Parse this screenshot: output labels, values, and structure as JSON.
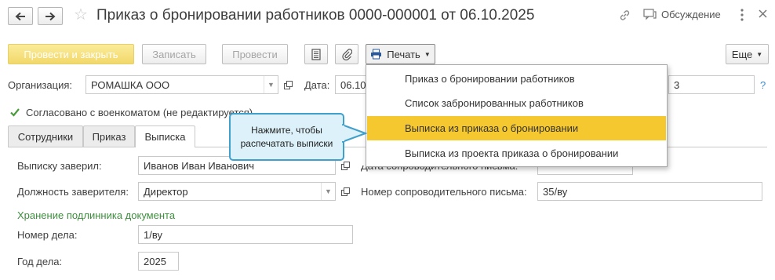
{
  "window": {
    "title": "Приказ о бронировании работников 0000-000001 от 06.10.2025",
    "discussion_label": "Обсуждение"
  },
  "icons": {
    "back": "arrow-left-icon",
    "forward": "arrow-right-icon",
    "favorite": "star-icon",
    "link": "link-icon",
    "discussion": "chat-icon",
    "more": "more-vertical-icon",
    "close": "close-icon"
  },
  "toolbar": {
    "post_close": "Провести и закрыть",
    "save": "Записать",
    "post": "Провести",
    "print": "Печать",
    "more": "Еще"
  },
  "header": {
    "org_label": "Организация:",
    "org_value": "РОМАШКА ООО",
    "date_label": "Дата:",
    "date_value": "06.10",
    "number_value": "3",
    "help": "?",
    "agreed_label": "Согласовано с военкоматом (не редактируется)",
    "agreed_checked": true
  },
  "tabs": [
    {
      "label": "Сотрудники",
      "active": false
    },
    {
      "label": "Приказ",
      "active": false
    },
    {
      "label": "Выписка",
      "active": true
    }
  ],
  "form": {
    "certified_label": "Выписку заверил:",
    "certified_value": "Иванов Иван Иванович",
    "position_label": "Должность заверителя:",
    "position_value": "Директор",
    "storage_header": "Хранение подлинника документа",
    "case_number_label": "Номер дела:",
    "case_number_value": "1/ву",
    "case_year_label": "Год дела:",
    "case_year_value": "2025",
    "letter_date_label": "Дата сопроводительного письма:",
    "letter_number_label": "Номер сопроводительного письма:",
    "letter_number_value": "35/ву"
  },
  "print_menu": {
    "items": [
      "Приказ о бронировании работников",
      "Список забронированных работников",
      "Выписка из приказа о бронировании",
      "Выписка из проекта приказа о бронировании"
    ],
    "highlighted_index": 2
  },
  "callout": {
    "text": "Нажмите, чтобы распечатать выписки"
  },
  "colors": {
    "accent_yellow": "#f6c82f",
    "primary_button": "#f2d86a",
    "callout_border": "#3fa0cb",
    "callout_fill": "#dcf1f9",
    "section_green": "#3e8f3e",
    "checkbox_green": "#4a9b3a"
  }
}
